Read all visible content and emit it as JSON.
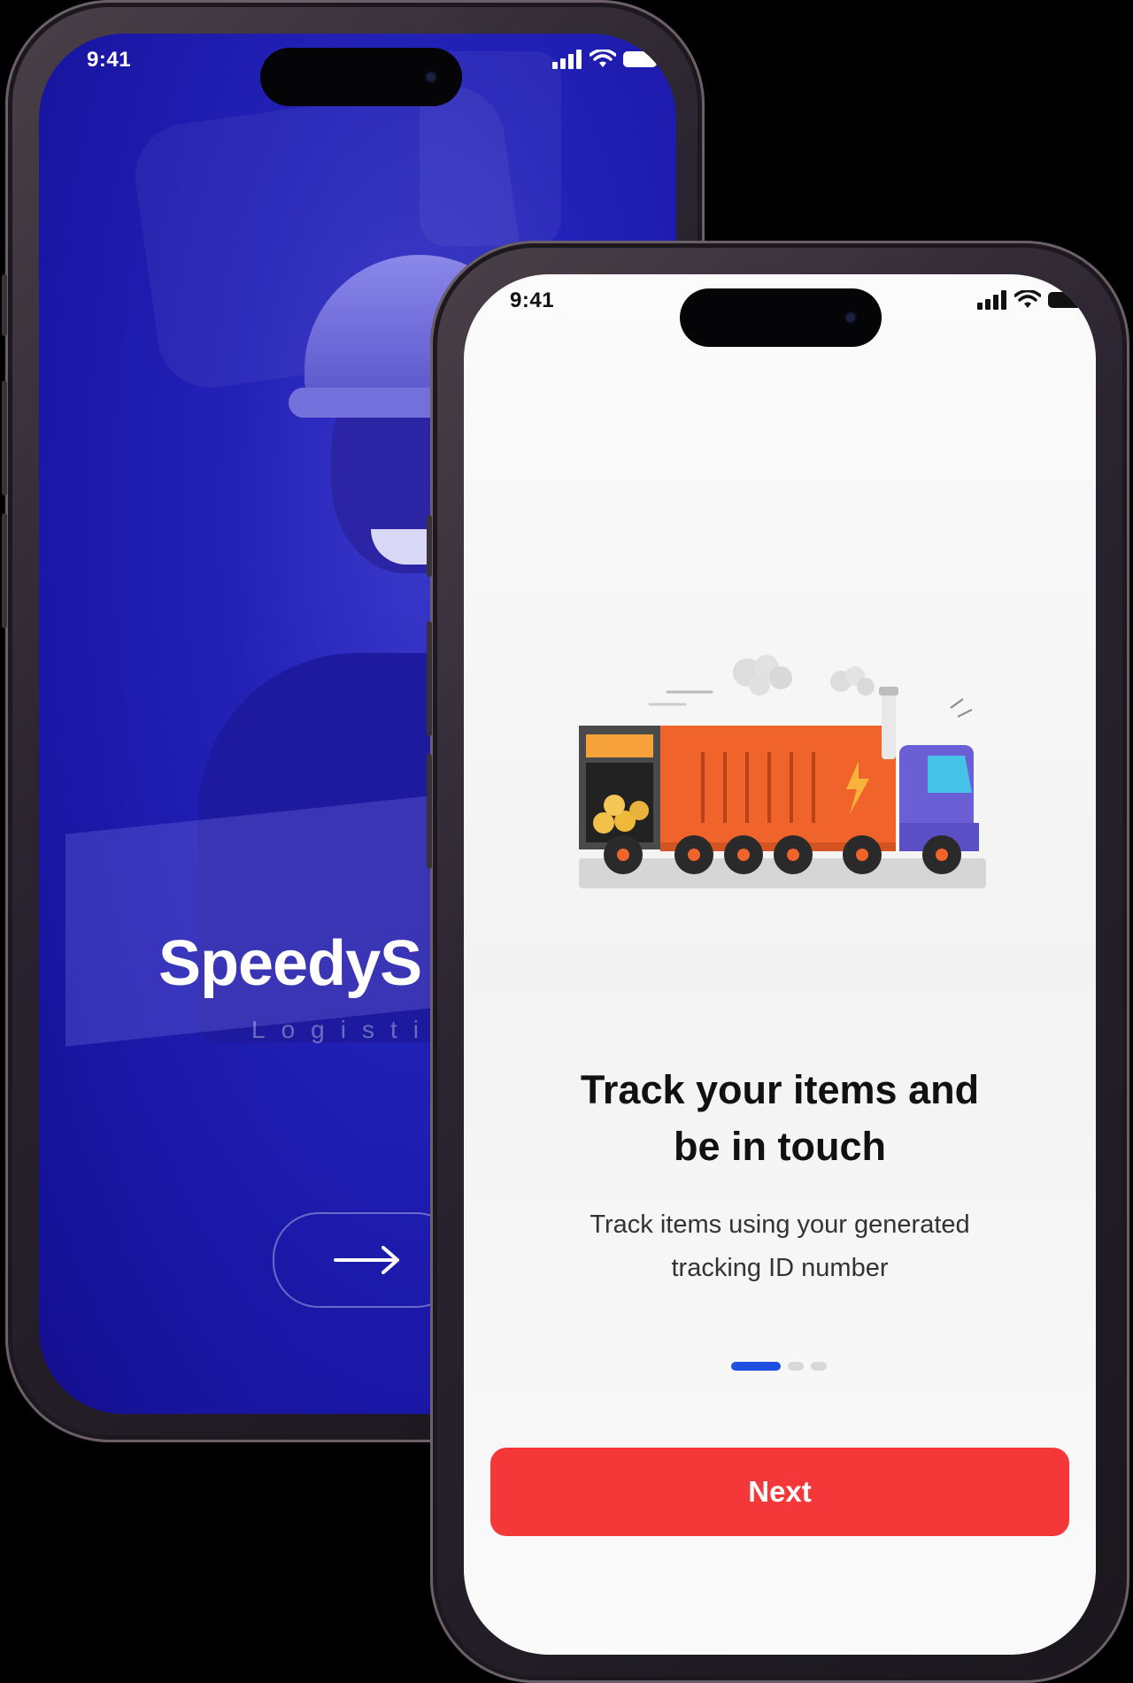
{
  "colors": {
    "brand_blue": "#2322b8",
    "accent_red": "#f4383a",
    "indicator_blue": "#1f4fe0"
  },
  "splash_screen": {
    "status_time": "9:41",
    "brand_title": "SpeedyS",
    "brand_subtitle": "Logistic",
    "arrow_icon": "arrow-right-icon"
  },
  "onboarding_screen": {
    "status_time": "9:41",
    "illustration": "delivery-truck",
    "headline_line1": "Track your items and",
    "headline_line2": "be in touch",
    "subtext_line1": "Track items using your generated",
    "subtext_line2": "tracking ID number",
    "page_indicator": {
      "total": 3,
      "active": 1
    },
    "next_label": "Next"
  }
}
